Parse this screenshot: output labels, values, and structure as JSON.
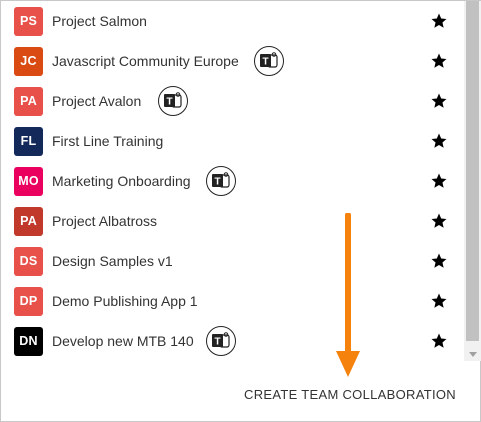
{
  "teams": [
    {
      "initials": "PS",
      "name": "Project Salmon",
      "color": "#e8504a",
      "has_teams_icon": false
    },
    {
      "initials": "JC",
      "name": "Javascript Community Europe",
      "color": "#d94b12",
      "has_teams_icon": true
    },
    {
      "initials": "PA",
      "name": "Project Avalon",
      "color": "#e8504a",
      "has_teams_icon": true
    },
    {
      "initials": "FL",
      "name": "First Line Training",
      "color": "#12295a",
      "has_teams_icon": false
    },
    {
      "initials": "MO",
      "name": "Marketing Onboarding",
      "color": "#ea005e",
      "has_teams_icon": true
    },
    {
      "initials": "PA",
      "name": "Project Albatross",
      "color": "#c0392b",
      "has_teams_icon": false
    },
    {
      "initials": "DS",
      "name": "Design Samples v1",
      "color": "#e8504a",
      "has_teams_icon": false
    },
    {
      "initials": "DP",
      "name": "Demo Publishing App 1",
      "color": "#e8504a",
      "has_teams_icon": false
    },
    {
      "initials": "DN",
      "name": "Develop new MTB 140",
      "color": "#000000",
      "has_teams_icon": true
    }
  ],
  "teams_icon_letter": "T",
  "create_button_label": "CREATE TEAM COLLABORATION",
  "arrow_color": "#f5820d",
  "star_color": "#000000"
}
